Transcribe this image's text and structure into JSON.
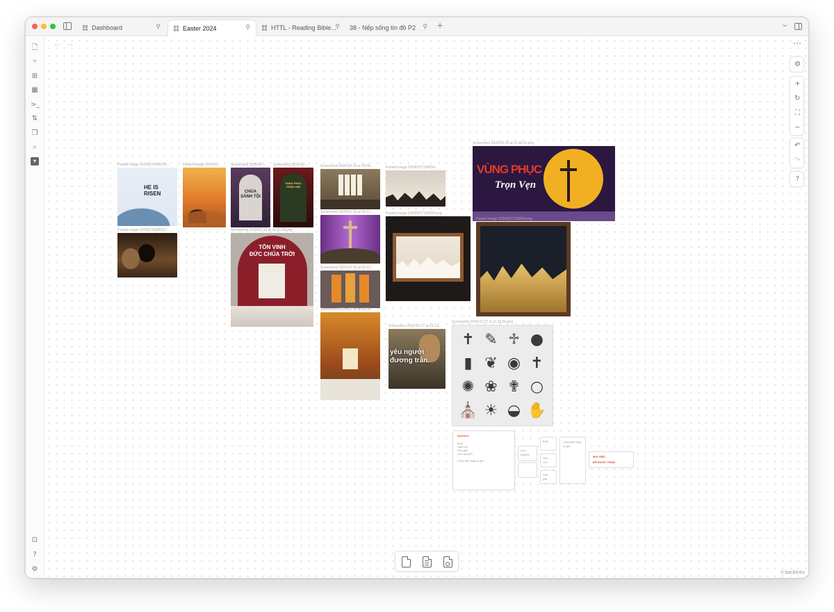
{
  "tabs": [
    {
      "label": "Dashboard",
      "active": false
    },
    {
      "label": "Easter 2024",
      "active": true
    },
    {
      "label": "HTTL - Reading Bible...",
      "active": false
    },
    {
      "label": "38 - Nếp sống tín đồ P2",
      "active": false
    }
  ],
  "canvas": {
    "captions": {
      "c1": "Pasted image 20240216085236...",
      "c2": "Pasted image 202402l...",
      "c3": "Screenshot 2024-02-...",
      "c4": "Screenshot 2024-02-...",
      "c5": "Screenshot 2024-02-16 at 09.08...",
      "c6": "Pasted image 20240227194854...",
      "c7": "Screenshot 2024-02-29 at 11.36.01.png",
      "c8": "Pasted image 20240216085317...",
      "c9": "Screenshot 2024-02-16 at 09.11...",
      "c10": "Screenshot 2024-02-16 at 09.10.38.png",
      "c11": "Pasted image 20240227194559.png",
      "c12": "Pasted image 20240227195009.png",
      "c13": "Screenshot 2024-02-16 at 09.12...",
      "c14": "Screenshot 2024-02-16 at 09.06...",
      "c15": "Screenshot 2024-02-27 at 12.13...",
      "c16": "Screenshot 2024-02-27 at 11.53.50.png"
    },
    "image_text": {
      "he_is_risen": "HE IS\nRISEN",
      "chua": "CHÚA\nSÁNH TỘI",
      "vung_phuc_small": "VÙNG PHỤC\nTRỌN VẸN",
      "ton_vinh": "TÔN VINH\nĐỨC CHÚA TRỜI",
      "vung_phuc_big": "VÙNG PHỤC",
      "tron_ven": "Trọn Vẹn",
      "yeu_nguoi": "yêu người\nđương trần."
    },
    "cards": {
      "symbols_title": "Symbols",
      "symbols_lines": [
        "Bình",
        "Giải cứu",
        "Hòa giải",
        "Cứu nguyên"
      ],
      "symbols_footer": "Chúa đến thập tự giá",
      "small_a": "Cứu\nnguyên",
      "small_b": "Bình",
      "small_c": "Giải\ncứu",
      "small_d": "Hòa\ngiải",
      "tall_text": "Chúa đến thập\ntự giá",
      "moi_viec": "MỌI VIỆC",
      "da_duoc_tron": "ĐÃ ĐƯỢC TRỌN"
    }
  },
  "backlinks": "0 backlinks",
  "colors": {
    "accent": "#e0622a",
    "purple_banner": "#2b1740",
    "church_red": "#8a1f2a"
  },
  "icons": {
    "ribbon": [
      "file-icon",
      "graph-icon",
      "canvas-icon",
      "calendar-icon",
      "terminal-icon",
      "sliders-icon",
      "copy-icon",
      "search-icon",
      "extension-icon"
    ],
    "ribbon_bottom": [
      "vault-icon",
      "help-icon",
      "settings-icon"
    ],
    "controls": [
      "settings-icon",
      "zoom-in-icon",
      "reset-icon",
      "fit-icon",
      "zoom-out-icon",
      "undo-icon",
      "redo-icon",
      "help-icon"
    ],
    "bottombar": [
      "new-note-icon",
      "new-text-icon",
      "new-media-icon"
    ]
  }
}
